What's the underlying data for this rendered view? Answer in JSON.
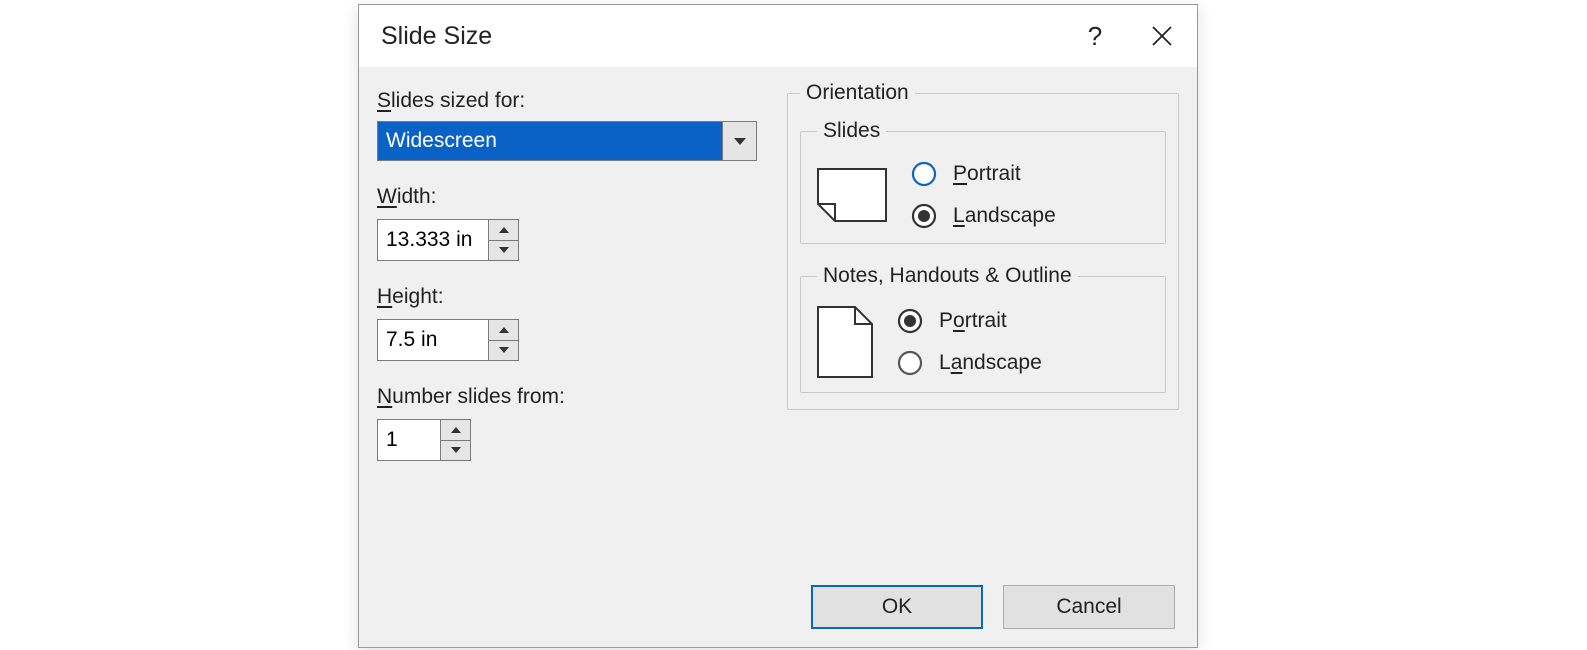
{
  "dialog": {
    "title": "Slide Size",
    "slides_sized_for_label": "Slides sized for:",
    "slides_sized_for_value": "Widescreen",
    "width_label": "Width:",
    "width_value": "13.333 in",
    "height_label": "Height:",
    "height_value": "7.5 in",
    "number_from_label": "Number slides from:",
    "number_from_value": "1",
    "orientation_label": "Orientation",
    "slides_group_label": "Slides",
    "notes_group_label": "Notes, Handouts & Outline",
    "portrait_label": "Portrait",
    "landscape_label": "Landscape",
    "slides_orientation_selected": "Landscape",
    "notes_orientation_selected": "Portrait",
    "ok_label": "OK",
    "cancel_label": "Cancel"
  }
}
